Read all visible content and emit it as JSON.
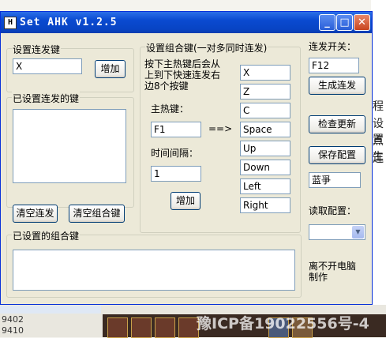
{
  "window": {
    "icon_letter": "H",
    "title": "Set AHK v1.2.5",
    "controls": {
      "minimize": "_",
      "maximize": "□",
      "close": "✕"
    }
  },
  "left": {
    "set_key_group": "设置连发键",
    "key_value": "X",
    "add_button": "增加",
    "set_keys_group": "已设置连发的键",
    "clear_burst_button": "清空连发",
    "clear_combo_button": "清空组合键"
  },
  "combo": {
    "group_label": "设置组合键(一对多同时连发)",
    "instruction": [
      "按下主热键后会从",
      "上到下快速连发右",
      "边8个按键"
    ],
    "main_hotkey_label": "主热键：",
    "main_hotkey_value": "F1",
    "arrow": "==>",
    "interval_label": "时间间隔：",
    "interval_value": "1",
    "add_button": "增加",
    "keys": [
      "X",
      "Z",
      "C",
      "Space",
      "Up",
      "Down",
      "Left",
      "Right"
    ]
  },
  "right": {
    "toggle_label": "连发开关：",
    "toggle_value": "F12",
    "generate_button": "生成连发",
    "check_update_button": "检查更新",
    "save_config_button": "保存配置",
    "config_name": "蓝爭",
    "load_config_label": "读取配置：",
    "load_config_value": "",
    "notice": [
      "离不开电脑",
      "制作"
    ]
  },
  "bottom": {
    "set_combo_group": "已设置的组合键"
  },
  "background": {
    "side_text": [
      "程",
      "设置",
      "点生",
      "连"
    ],
    "numbers": [
      "9402",
      "9410"
    ],
    "watermark": "豫ICP备19022556号-4"
  }
}
